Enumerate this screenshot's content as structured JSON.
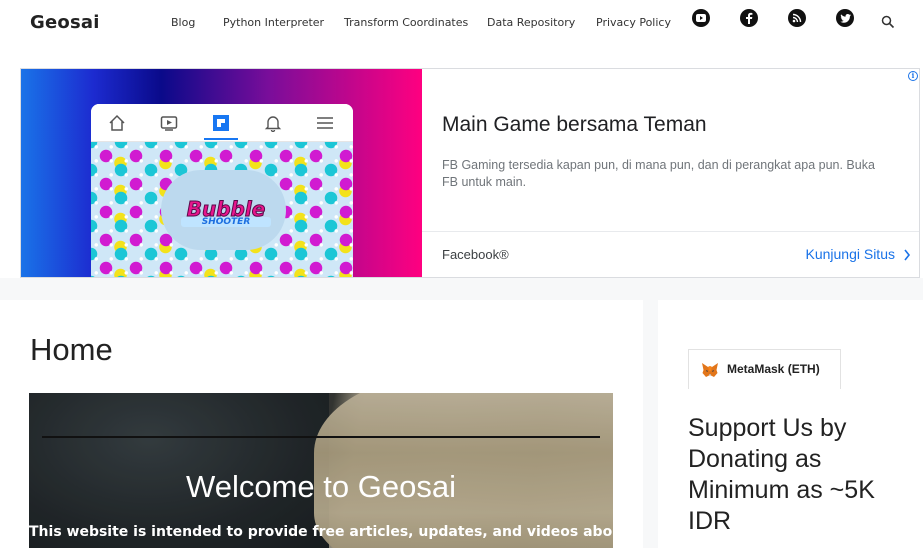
{
  "header": {
    "logo": "Geosai",
    "nav": [
      {
        "label": "Blog"
      },
      {
        "label": "Python Interpreter"
      },
      {
        "label": "Transform Coordinates"
      },
      {
        "label": "Data Repository"
      },
      {
        "label": "Privacy Policy"
      }
    ],
    "social_icons": [
      "youtube-icon",
      "facebook-icon",
      "rss-icon",
      "twitter-icon"
    ],
    "search_icon": "search-icon"
  },
  "ad": {
    "title": "Main Game bersama Teman",
    "description": "FB Gaming tersedia kapan pun, di mana pun, dan di perangkat apa pun. Buka FB untuk main.",
    "advertiser": "Facebook®",
    "cta": "Kunjungi Situs",
    "game_logo": {
      "line1": "Bubble",
      "line2": "SHOOTER"
    },
    "colors": {
      "cta": "#1a73e8",
      "gradient_start": "#1a73e8",
      "gradient_end": "#ff0080"
    }
  },
  "main": {
    "page_title": "Home",
    "hero": {
      "heading": "Welcome to Geosai",
      "subtitle": "This website is intended to provide free articles, updates, and videos about"
    }
  },
  "sidebar": {
    "wallet_tab": "MetaMask (ETH)",
    "support_title": "Support Us by Donating as Minimum as ~5K IDR"
  }
}
